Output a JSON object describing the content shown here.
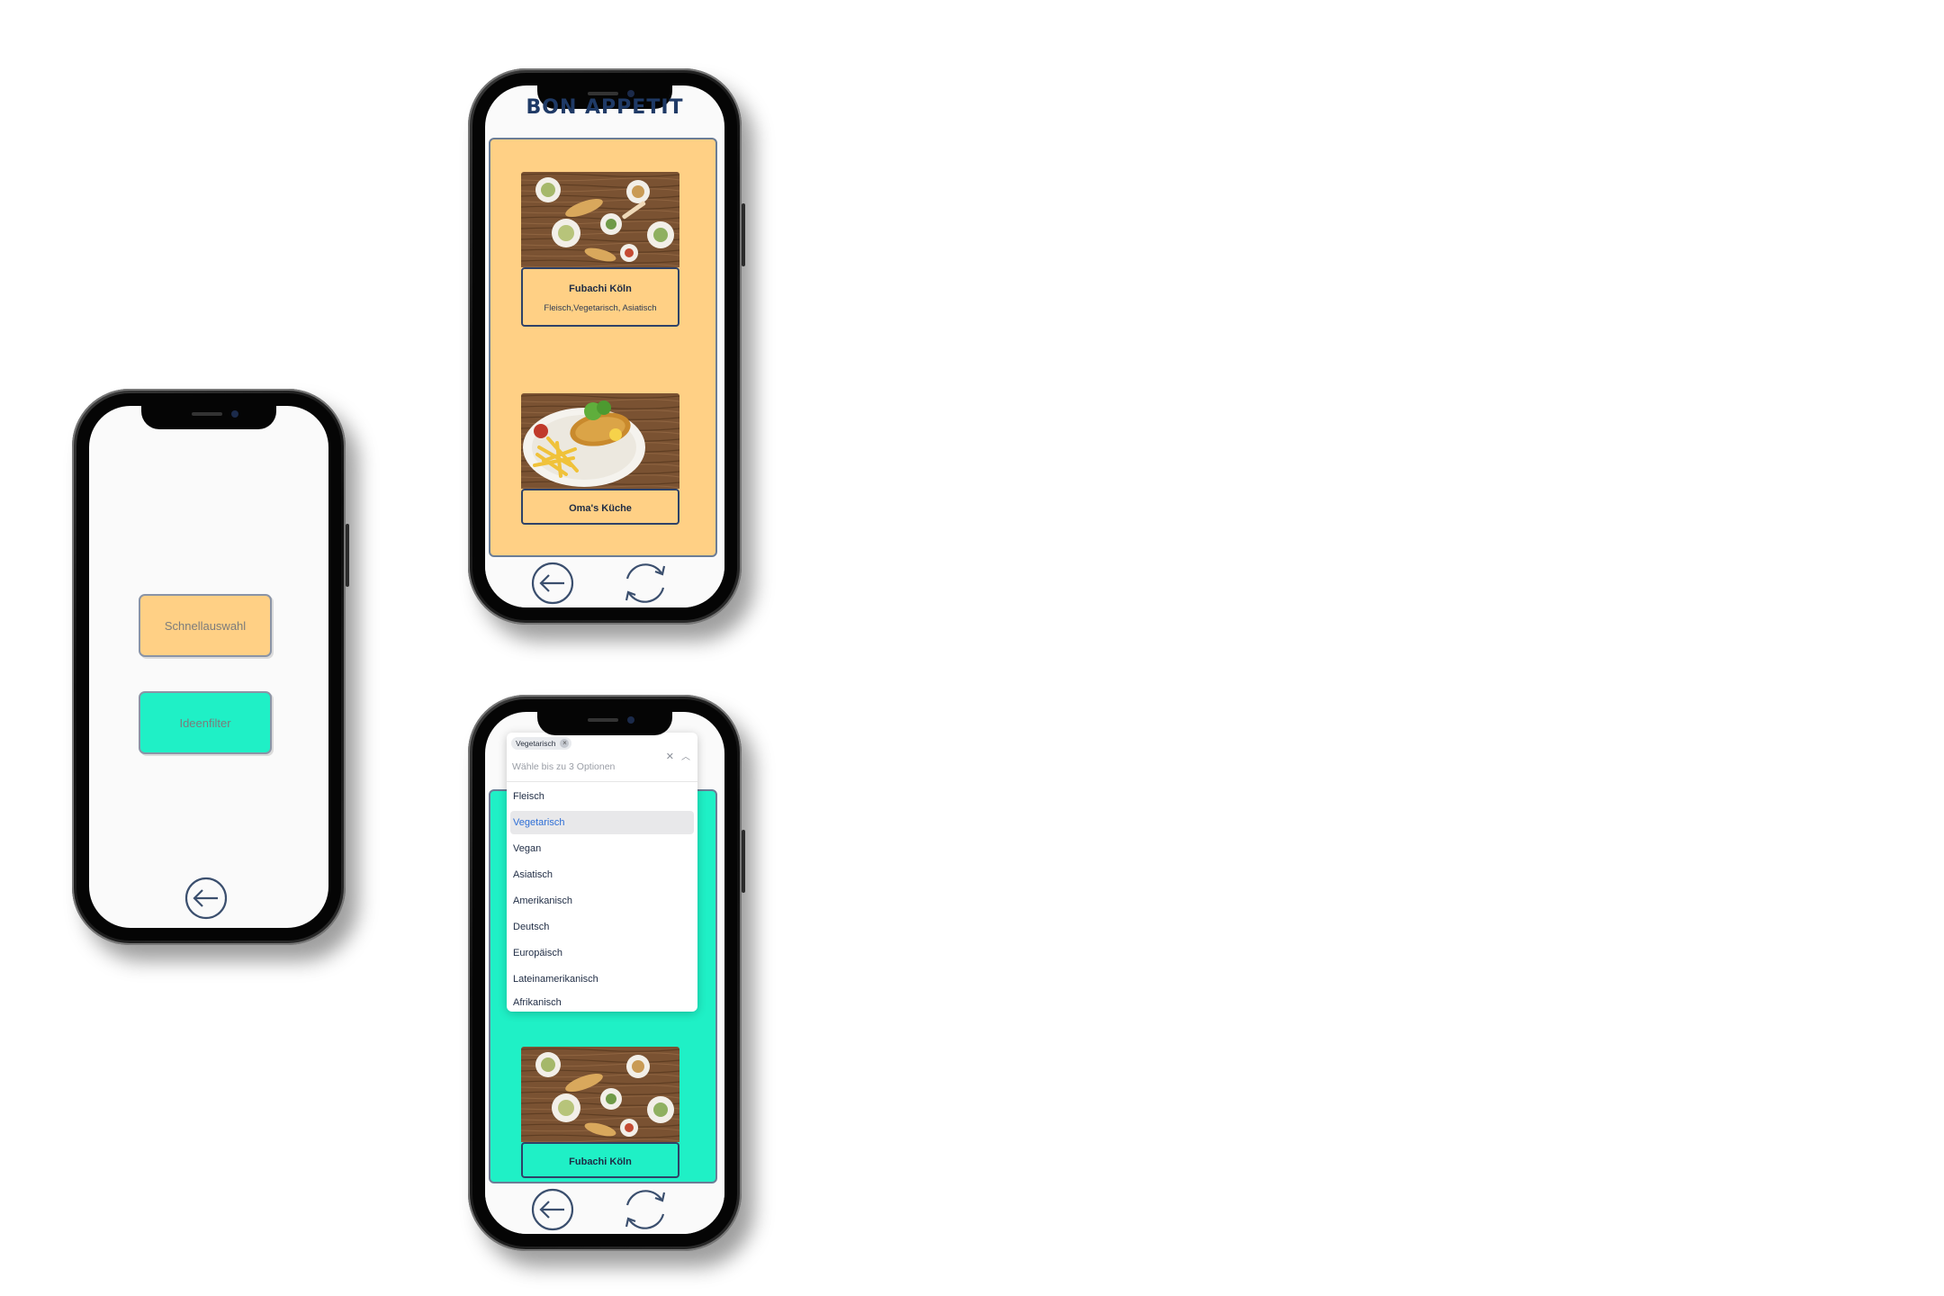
{
  "colors": {
    "apricot": "#ffd085",
    "aqua": "#1ff0c6",
    "navy": "#1f3a66",
    "outline": "#2e4268",
    "screen_bg": "#fafafa"
  },
  "phone_menu": {
    "quick_select_label": "Schnellauswahl",
    "idea_filter_label": "Ideenfilter",
    "back_icon": "arrow-left-circle-icon"
  },
  "phone_results": {
    "title": "BON APPETIT",
    "restaurants": [
      {
        "name": "Fubachi Köln",
        "tags": "Fleisch,Vegetarisch, Asiatisch"
      },
      {
        "name": "Oma's Küche"
      }
    ],
    "back_icon": "arrow-left-circle-icon",
    "refresh_icon": "refresh-icon"
  },
  "phone_filter": {
    "dropdown": {
      "chip": "Vegetarisch",
      "placeholder": "Wähle bis zu 3 Optionen",
      "options": [
        "Fleisch",
        "Vegetarisch",
        "Vegan",
        "Asiatisch",
        "Amerikanisch",
        "Deutsch",
        "Europäisch",
        "Lateinamerikanisch",
        "Afrikanisch"
      ],
      "selected": "Vegetarisch"
    },
    "restaurant": {
      "name": "Fubachi Köln"
    },
    "back_icon": "arrow-left-circle-icon",
    "refresh_icon": "refresh-icon"
  }
}
